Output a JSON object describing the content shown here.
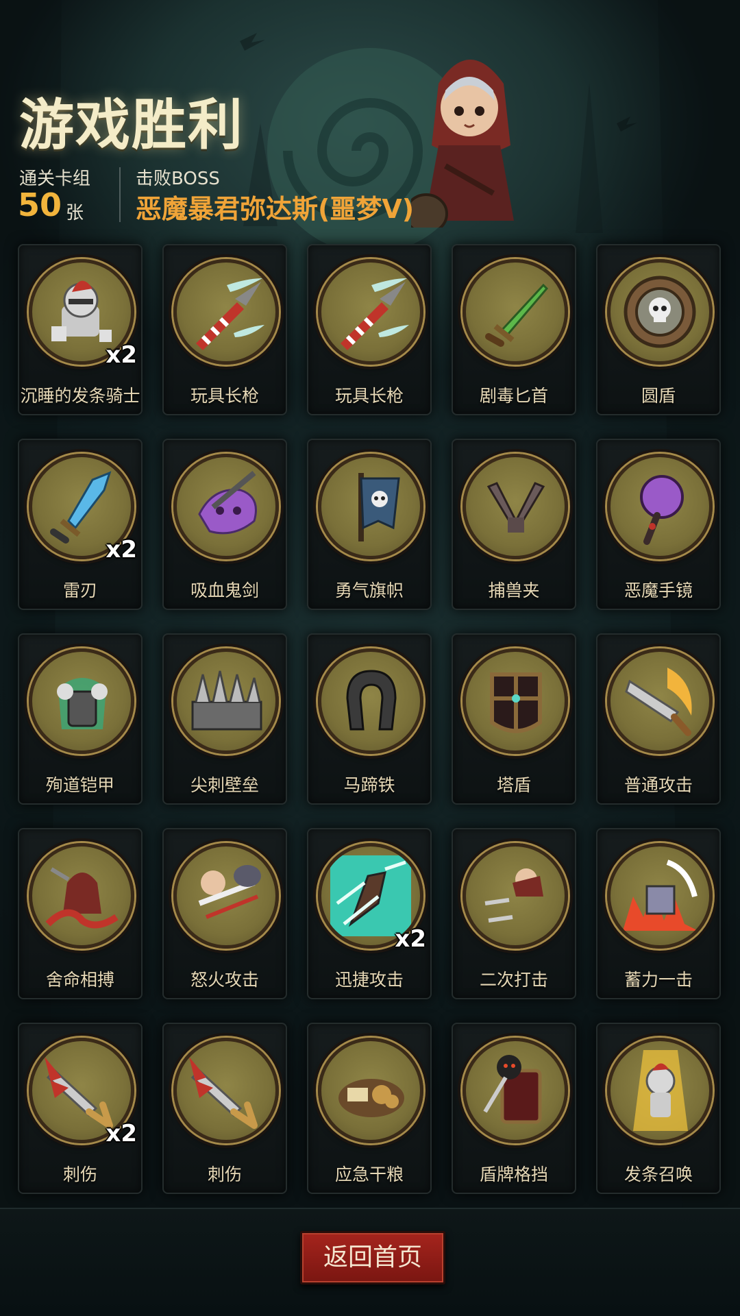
{
  "header": {
    "title": "游戏胜利",
    "deck_label": "通关卡组",
    "deck_count": "50",
    "deck_unit": "张",
    "boss_label": "击败BOSS",
    "boss_name": "恶魔暴君弥达斯(噩梦V)"
  },
  "cards": [
    {
      "name": "沉睡的发条骑士",
      "count": "x2",
      "icon": "sleeping-knight-icon"
    },
    {
      "name": "玩具长枪",
      "count": "",
      "icon": "toy-lance-icon"
    },
    {
      "name": "玩具长枪",
      "count": "",
      "icon": "toy-lance-icon"
    },
    {
      "name": "剧毒匕首",
      "count": "",
      "icon": "poison-dagger-icon"
    },
    {
      "name": "圆盾",
      "count": "",
      "icon": "round-shield-icon"
    },
    {
      "name": "雷刃",
      "count": "x2",
      "icon": "thunder-blade-icon"
    },
    {
      "name": "吸血鬼剑",
      "count": "",
      "icon": "vampire-sword-icon"
    },
    {
      "name": "勇气旗帜",
      "count": "",
      "icon": "courage-banner-icon"
    },
    {
      "name": "捕兽夹",
      "count": "",
      "icon": "bear-trap-icon"
    },
    {
      "name": "恶魔手镜",
      "count": "",
      "icon": "demon-mirror-icon"
    },
    {
      "name": "殉道铠甲",
      "count": "",
      "icon": "martyr-armor-icon"
    },
    {
      "name": "尖刺壁垒",
      "count": "",
      "icon": "spike-wall-icon"
    },
    {
      "name": "马蹄铁",
      "count": "",
      "icon": "horseshoe-icon"
    },
    {
      "name": "塔盾",
      "count": "",
      "icon": "tower-shield-icon"
    },
    {
      "name": "普通攻击",
      "count": "",
      "icon": "normal-attack-icon"
    },
    {
      "name": "舍命相搏",
      "count": "",
      "icon": "desperate-fight-icon"
    },
    {
      "name": "怒火攻击",
      "count": "",
      "icon": "rage-attack-icon"
    },
    {
      "name": "迅捷攻击",
      "count": "x2",
      "icon": "swift-attack-icon"
    },
    {
      "name": "二次打击",
      "count": "",
      "icon": "double-strike-icon"
    },
    {
      "name": "蓄力一击",
      "count": "",
      "icon": "charged-strike-icon"
    },
    {
      "name": "刺伤",
      "count": "x2",
      "icon": "stab-icon"
    },
    {
      "name": "刺伤",
      "count": "",
      "icon": "stab-icon"
    },
    {
      "name": "应急干粮",
      "count": "",
      "icon": "ration-icon"
    },
    {
      "name": "盾牌格挡",
      "count": "",
      "icon": "shield-block-icon"
    },
    {
      "name": "发条召唤",
      "count": "",
      "icon": "clockwork-summon-icon"
    }
  ],
  "footer": {
    "home_label": "返回首页"
  },
  "colors": {
    "title": "#f4ecc8",
    "accent_orange": "#f0a438",
    "button_red": "#a5241d",
    "medal": "#8f8547"
  }
}
